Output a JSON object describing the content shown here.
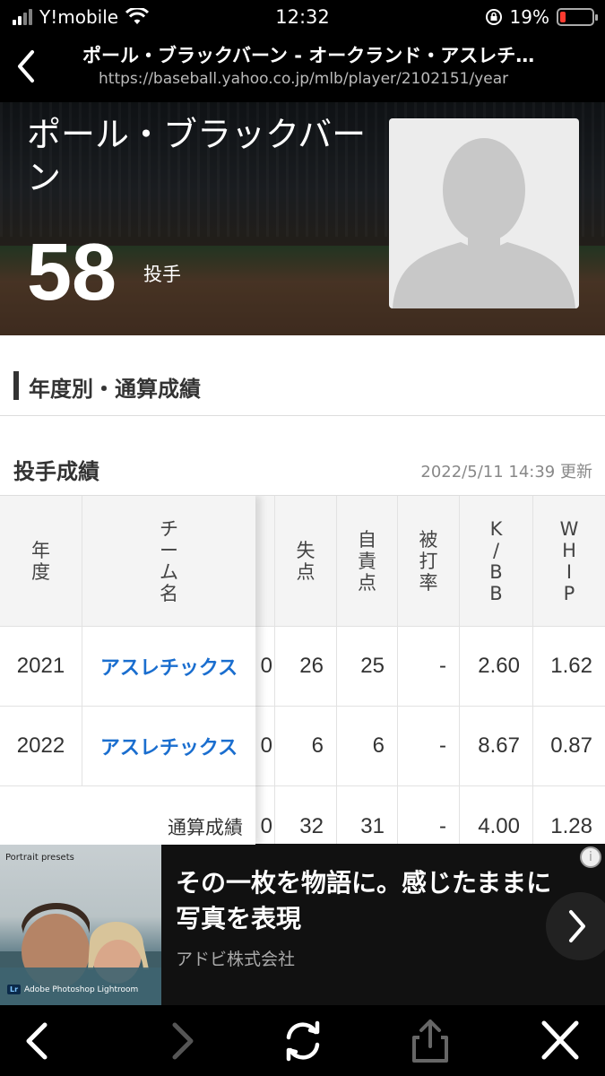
{
  "status_bar": {
    "carrier": "Y!mobile",
    "time": "12:32",
    "battery": "19%",
    "battery_level": 0.19
  },
  "nav": {
    "title": "ポール・ブラックバーン - オークランド・アスレチ…",
    "url": "https://baseball.yahoo.co.jp/mlb/player/2102151/year"
  },
  "player": {
    "name": "ポール・ブラックバーン",
    "number": "58",
    "position": "投手"
  },
  "section": {
    "title": "年度別・通算成績"
  },
  "pitching": {
    "title": "投手成績",
    "updated": "2022/5/11 14:39 更新",
    "headers": {
      "year": "年度",
      "team": "チーム名",
      "runs": "失点",
      "earned_runs": "自責点",
      "opp_avg": "被打率",
      "k_bb": "K/BB",
      "whip": "WHIP"
    },
    "rows": [
      {
        "year": "2021",
        "team": "アスレチックス",
        "hidden": "0",
        "runs": "26",
        "earned_runs": "25",
        "opp_avg": "-",
        "k_bb": "2.60",
        "whip": "1.62"
      },
      {
        "year": "2022",
        "team": "アスレチックス",
        "hidden": "0",
        "runs": "6",
        "earned_runs": "6",
        "opp_avg": "-",
        "k_bb": "8.67",
        "whip": "0.87"
      }
    ],
    "total": {
      "label": "通算成績",
      "hidden": "0",
      "runs": "32",
      "earned_runs": "31",
      "opp_avg": "-",
      "k_bb": "4.00",
      "whip": "1.28"
    }
  },
  "ad": {
    "photo_label": "Portrait presets",
    "photo_brand_badge": "Lr",
    "photo_brand": "Adobe Photoshop Lightroom",
    "headline": "その一枚を物語に。感じたままに写真を表現",
    "company": "アドビ株式会社"
  },
  "toolbar": {
    "icons": [
      "back-icon",
      "forward-icon",
      "reload-icon",
      "share-icon",
      "close-icon"
    ]
  }
}
